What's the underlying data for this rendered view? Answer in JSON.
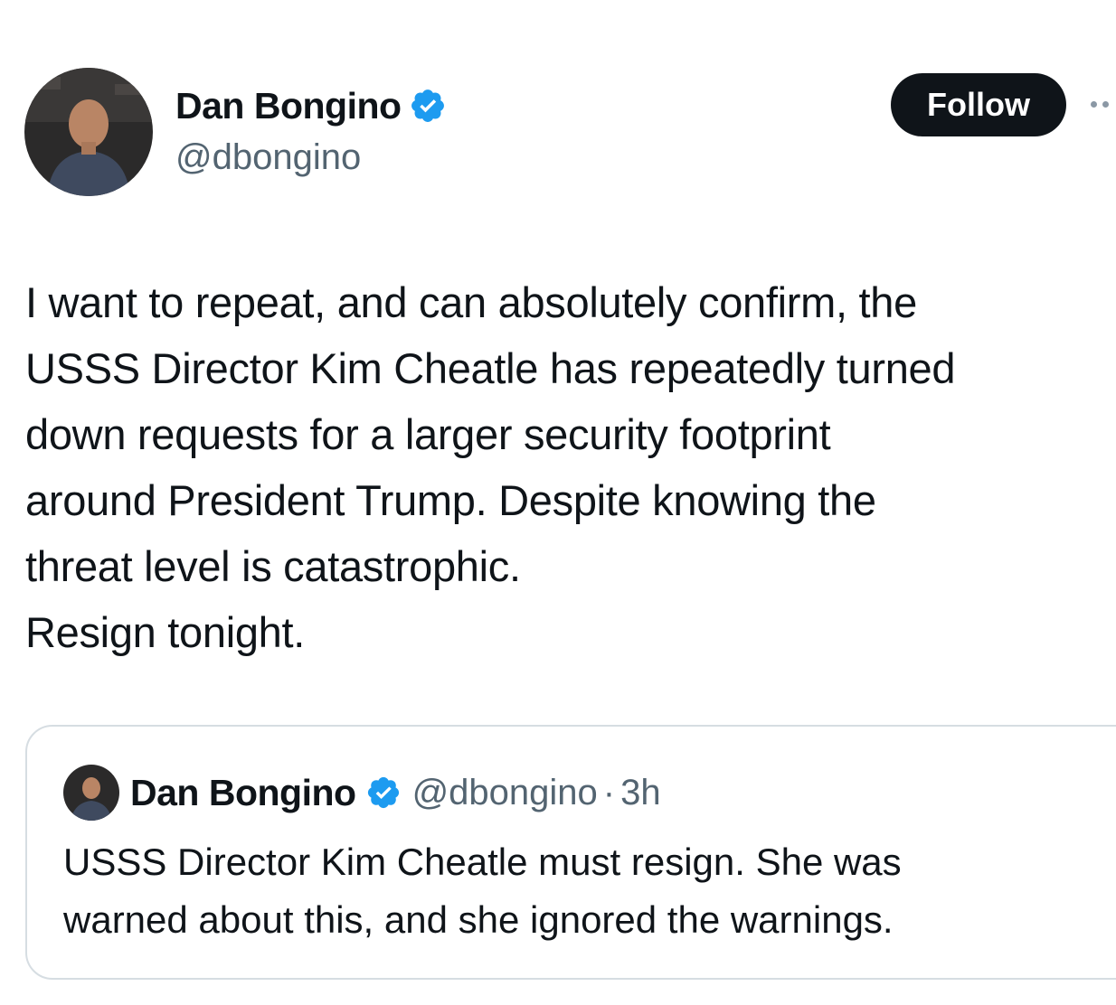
{
  "author": {
    "name": "Dan Bongino",
    "handle": "@dbongino",
    "verified_icon": "verified-badge-icon"
  },
  "header": {
    "follow_label": "Follow",
    "more_icon": "more-options-icon"
  },
  "tweet": {
    "lines": [
      "I want to repeat, and can absolutely confirm, the",
      "USSS Director Kim Cheatle has repeatedly turned",
      "down requests for a larger security footprint",
      "around President Trump. Despite knowing the",
      "threat level is catastrophic.",
      "Resign tonight."
    ]
  },
  "quote": {
    "name": "Dan Bongino",
    "handle": "@dbongino",
    "separator": "·",
    "time": "3h",
    "lines": [
      "USSS Director Kim Cheatle must resign. She was",
      "warned about this, and she ignored the warnings."
    ]
  },
  "colors": {
    "text": "#0f1419",
    "secondary": "#536471",
    "verified_blue": "#1d9bf0",
    "follow_bg": "#0f1419",
    "border": "#d6dde2"
  }
}
